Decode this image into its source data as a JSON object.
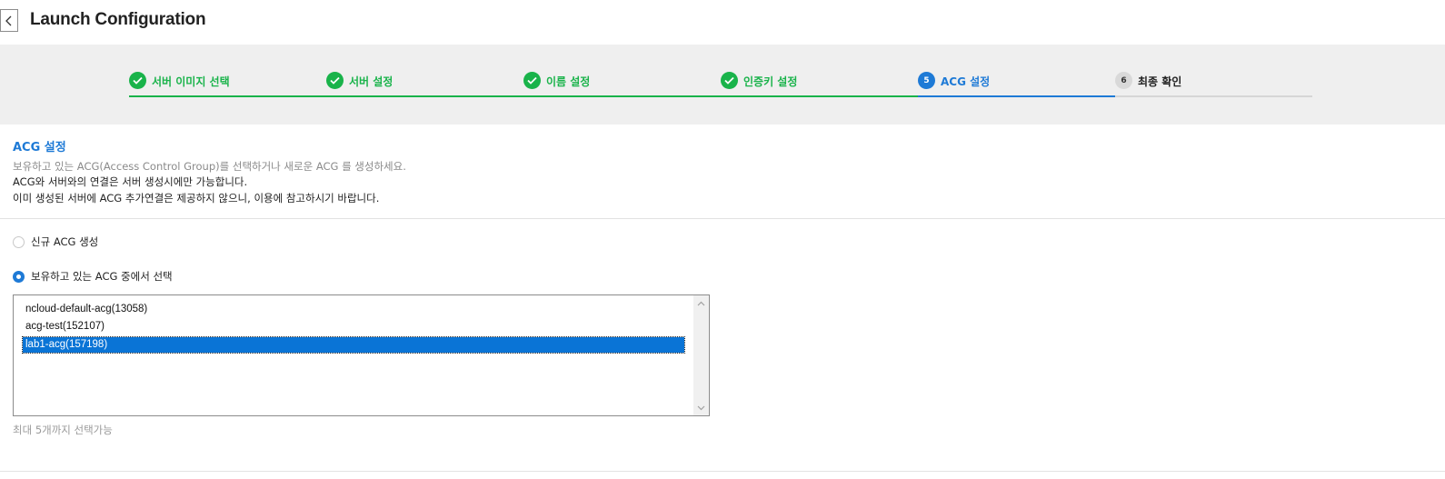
{
  "header": {
    "title": "Launch Configuration",
    "back_icon": "chevron-left-icon"
  },
  "steps": [
    {
      "number": "1",
      "label": "서버 이미지 선택",
      "status": "done"
    },
    {
      "number": "2",
      "label": "서버 설정",
      "status": "done"
    },
    {
      "number": "3",
      "label": "이름 설정",
      "status": "done"
    },
    {
      "number": "4",
      "label": "인증키 설정",
      "status": "done"
    },
    {
      "number": "5",
      "label": "ACG 설정",
      "status": "active"
    },
    {
      "number": "6",
      "label": "최종 확인",
      "status": "pending"
    }
  ],
  "section": {
    "title": "ACG 설정",
    "desc1": "보유하고 있는 ACG(Access Control Group)를 선택하거나 새로운 ACG 를 생성하세요.",
    "desc2": "ACG와 서버와의 연결은 서버 생성시에만 가능합니다.",
    "desc3": "이미 생성된 서버에 ACG 추가연결은 제공하지 않으니, 이용에 참고하시기 바랍니다."
  },
  "options": {
    "new_acg": {
      "label": "신규 ACG 생성",
      "checked": false
    },
    "existing_acg": {
      "label": "보유하고 있는 ACG 중에서 선택",
      "checked": true
    }
  },
  "acg_list": {
    "items": [
      {
        "label": "ncloud-default-acg(13058)",
        "selected": false
      },
      {
        "label": "acg-test(152107)",
        "selected": false
      },
      {
        "label": "lab1-acg(157198)",
        "selected": true
      }
    ],
    "hint": "최대 5개까지 선택가능"
  },
  "colors": {
    "done": "#19b34a",
    "active": "#1e7ad6",
    "pending": "#d9d9d9",
    "selection": "#0a74d6"
  }
}
